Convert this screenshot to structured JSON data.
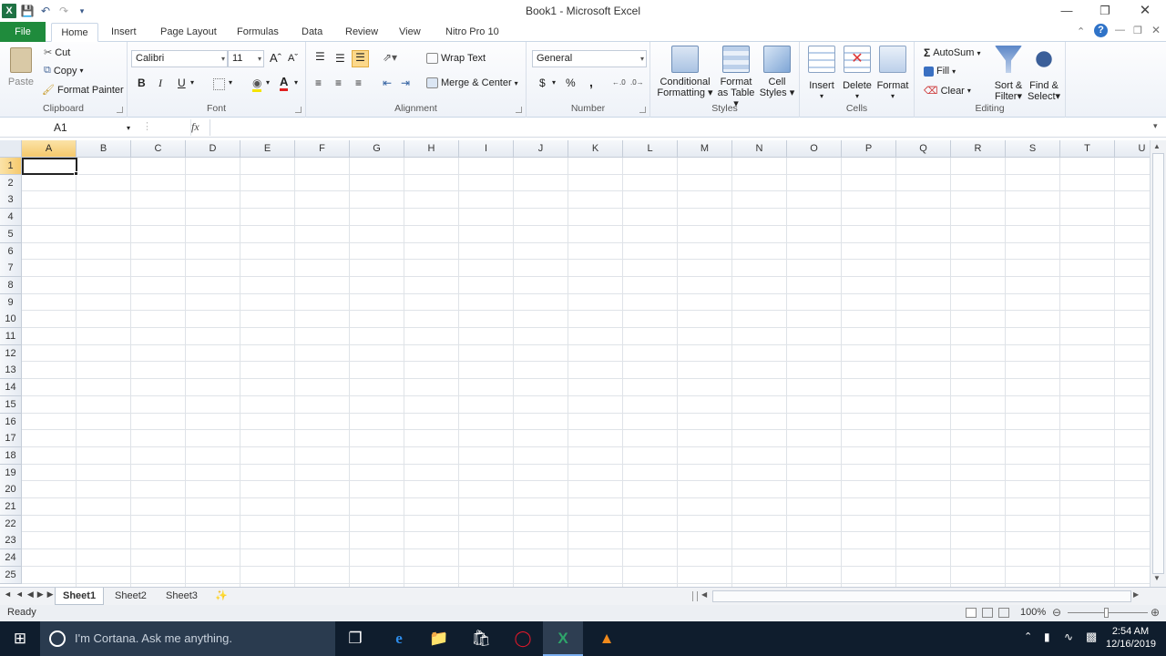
{
  "window": {
    "title": "Book1 - Microsoft Excel"
  },
  "tabs": [
    "File",
    "Home",
    "Insert",
    "Page Layout",
    "Formulas",
    "Data",
    "Review",
    "View",
    "Nitro Pro 10"
  ],
  "ribbon": {
    "clipboard": {
      "label": "Clipboard",
      "paste": "Paste",
      "cut": "Cut",
      "copy": "Copy",
      "format_painter": "Format Painter"
    },
    "font": {
      "label": "Font",
      "name": "Calibri",
      "size": "11",
      "bold": "B",
      "italic": "I",
      "underline": "U"
    },
    "alignment": {
      "label": "Alignment",
      "wrap": "Wrap Text",
      "merge": "Merge & Center"
    },
    "number": {
      "label": "Number",
      "format": "General",
      "currency": "$",
      "percent": "%",
      "comma": ","
    },
    "styles": {
      "label": "Styles",
      "cond1": "Conditional",
      "cond2": "Formatting",
      "fmt1": "Format",
      "fmt2": "as Table",
      "cell1": "Cell",
      "cell2": "Styles"
    },
    "cells": {
      "label": "Cells",
      "insert": "Insert",
      "delete": "Delete",
      "format": "Format"
    },
    "editing": {
      "label": "Editing",
      "autosum": "AutoSum",
      "fill": "Fill",
      "clear": "Clear",
      "sort1": "Sort &",
      "sort2": "Filter",
      "find1": "Find &",
      "find2": "Select"
    }
  },
  "formula_bar": {
    "name_box": "A1",
    "fx": "fx",
    "value": ""
  },
  "columns": [
    "A",
    "B",
    "C",
    "D",
    "E",
    "F",
    "G",
    "H",
    "I",
    "J",
    "K",
    "L",
    "M",
    "N",
    "O",
    "P",
    "Q",
    "R",
    "S",
    "T",
    "U"
  ],
  "rows": [
    "1",
    "2",
    "3",
    "4",
    "5",
    "6",
    "7",
    "8",
    "9",
    "10",
    "11",
    "12",
    "13",
    "14",
    "15",
    "16",
    "17",
    "18",
    "19",
    "20",
    "21",
    "22",
    "23",
    "24",
    "25"
  ],
  "selected_cell": "A1",
  "sheets": [
    "Sheet1",
    "Sheet2",
    "Sheet3"
  ],
  "status": {
    "mode": "Ready",
    "zoom": "100%"
  },
  "taskbar": {
    "cortana": "I'm Cortana. Ask me anything.",
    "time": "2:54 AM",
    "date": "12/16/2019"
  },
  "colors": {
    "file_tab": "#1f8b3c",
    "accent": "#1f7244",
    "taskbar": "#0f1d2d",
    "selected_header": "#f5c96c"
  }
}
